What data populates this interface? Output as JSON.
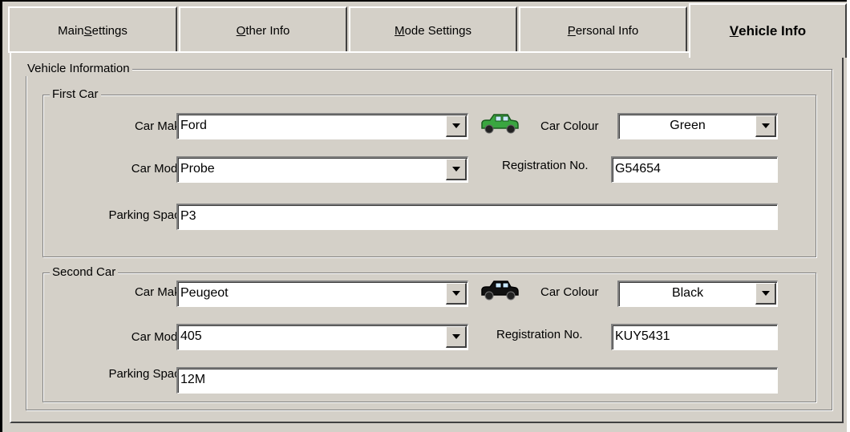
{
  "tabs": [
    {
      "pre": "Main ",
      "u": "S",
      "post": "ettings"
    },
    {
      "pre": "",
      "u": "O",
      "post": "ther Info"
    },
    {
      "pre": "",
      "u": "M",
      "post": "ode Settings"
    },
    {
      "pre": "",
      "u": "P",
      "post": "ersonal Info"
    },
    {
      "pre": "",
      "u": "V",
      "post": "ehicle Info"
    }
  ],
  "active_tab": "Vehicle Info",
  "vehicle_group": {
    "title": "Vehicle Information"
  },
  "first_car": {
    "title": "First Car",
    "make_label": "Car Make",
    "make": "Ford",
    "model_label": "Car Model",
    "model": "Probe",
    "parking_label": "Parking Space",
    "parking": "P3",
    "colour_label": "Car Colour",
    "colour": "Green",
    "reg_label": "Registration No.",
    "reg": "G54654",
    "car_color": "#3aa640"
  },
  "second_car": {
    "title": "Second Car",
    "make_label": "Car Make",
    "make": "Peugeot",
    "model_label": "Car Model",
    "model": "405",
    "parking_label": "Parking Space",
    "parking": "12M",
    "colour_label": "Car Colour",
    "colour": "Black",
    "reg_label": "Registration No.",
    "reg": "KUY5431",
    "car_color": "#111111"
  },
  "icons": {
    "car": "car-icon",
    "dropdown": "chevron-down-icon"
  }
}
